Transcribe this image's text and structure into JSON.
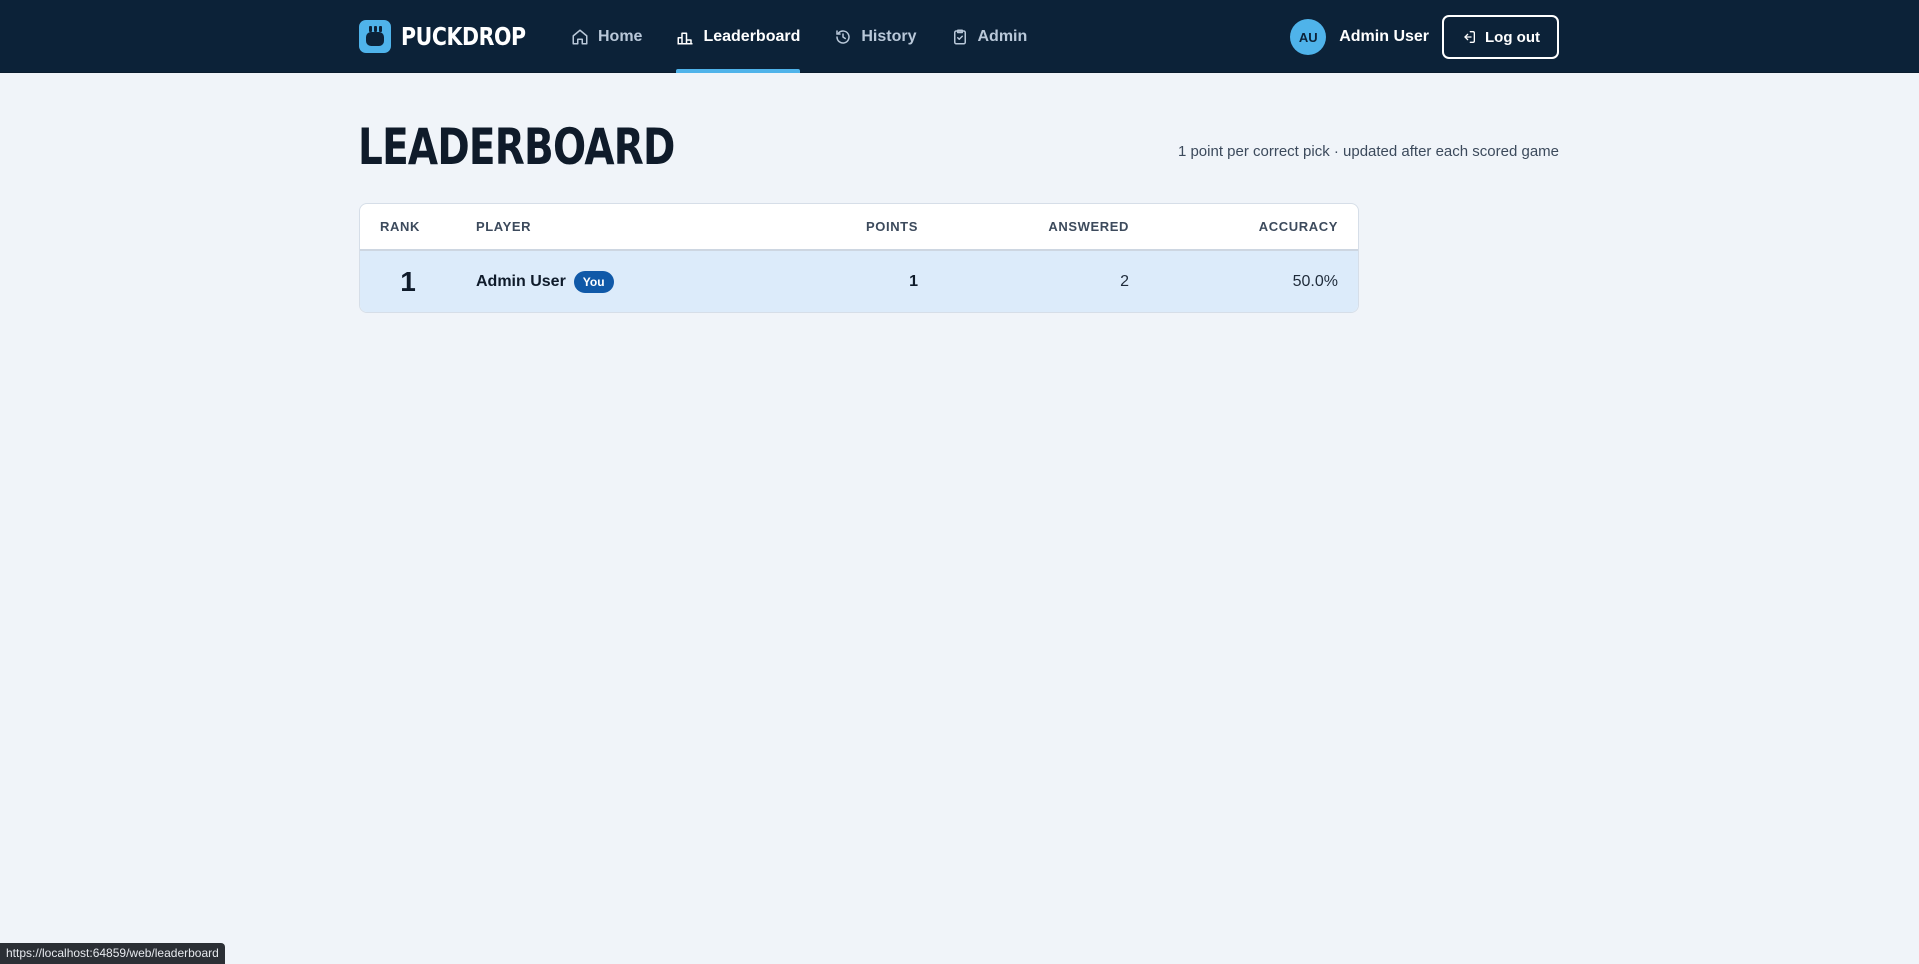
{
  "app": {
    "brand": "PUCKDROP"
  },
  "nav": {
    "items": [
      {
        "label": "Home",
        "icon": "home-icon"
      },
      {
        "label": "Leaderboard",
        "icon": "leaderboard-icon",
        "active": true
      },
      {
        "label": "History",
        "icon": "history-icon"
      },
      {
        "label": "Admin",
        "icon": "clipboard-check-icon"
      }
    ]
  },
  "user": {
    "initials": "AU",
    "name": "Admin User",
    "logout_label": "Log out"
  },
  "page": {
    "title": "LEADERBOARD",
    "subtitle": "1 point per correct pick · updated after each scored game"
  },
  "table": {
    "headers": {
      "rank": "RANK",
      "player": "PLAYER",
      "points": "POINTS",
      "answered": "ANSWERED",
      "accuracy": "ACCURACY"
    },
    "rows": [
      {
        "rank": "1",
        "player": "Admin User",
        "badge": "You",
        "points": "1",
        "answered": "2",
        "accuracy": "50.0%"
      }
    ]
  },
  "status_bar": {
    "url": "https://localhost:64859/web/leaderboard"
  },
  "colors": {
    "topbar": "#0c2238",
    "accent": "#4fb3ea",
    "highlight_row": "#dcebfa",
    "badge": "#1059a8",
    "page_bg": "#f0f4f9"
  }
}
